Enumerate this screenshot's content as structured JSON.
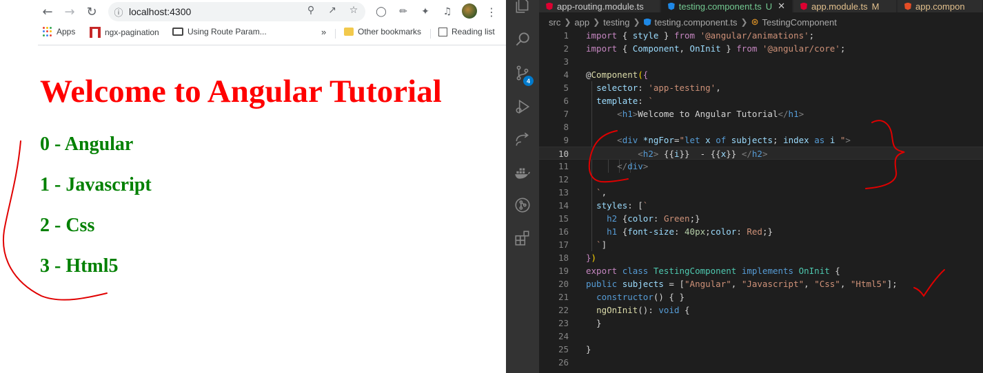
{
  "browser": {
    "url": "localhost:4300",
    "bookmarks": [
      {
        "label": "Apps"
      },
      {
        "label": "ngx-pagination"
      },
      {
        "label": "Using Route Param..."
      },
      {
        "label": "»"
      },
      {
        "label": "Other bookmarks"
      },
      {
        "label": "Reading list"
      }
    ],
    "page": {
      "heading": "Welcome to Angular Tutorial",
      "items": [
        "0 - Angular",
        "1 - Javascript",
        "2 - Css",
        "3 - Html5"
      ]
    }
  },
  "vscode": {
    "tabs": [
      {
        "label": "app-routing.module.ts",
        "badge": ""
      },
      {
        "label": "testing.component.ts",
        "badge": "U"
      },
      {
        "label": "app.module.ts",
        "badge": "M"
      },
      {
        "label": "app.compon",
        "badge": ""
      }
    ],
    "breadcrumb": [
      "src",
      "app",
      "testing",
      "testing.component.ts",
      "TestingComponent"
    ],
    "scm_badge": "4",
    "line_numbers": [
      "1",
      "2",
      "3",
      "4",
      "5",
      "6",
      "7",
      "8",
      "9",
      "10",
      "11",
      "12",
      "13",
      "14",
      "15",
      "16",
      "17",
      "18",
      "19",
      "20",
      "21",
      "22",
      "23",
      "24",
      "25",
      "26"
    ],
    "current_line": "10"
  },
  "colors": {
    "h1": "#ff0000",
    "h2": "#008000",
    "editor_bg": "#1e1e1e",
    "activity_bg": "#333333",
    "annotation": "#e00000"
  },
  "icons": [
    "back-arrow-icon",
    "forward-arrow-icon",
    "reload-icon",
    "info-icon",
    "zoom-icon",
    "share-icon",
    "star-icon",
    "extension-icon",
    "eyedropper-icon",
    "puzzle-icon",
    "media-icon",
    "menu-icon",
    "explorer-icon",
    "search-icon",
    "source-control-icon",
    "run-debug-icon",
    "remote-icon",
    "docker-icon",
    "gitlens-icon",
    "extensions-icon"
  ]
}
